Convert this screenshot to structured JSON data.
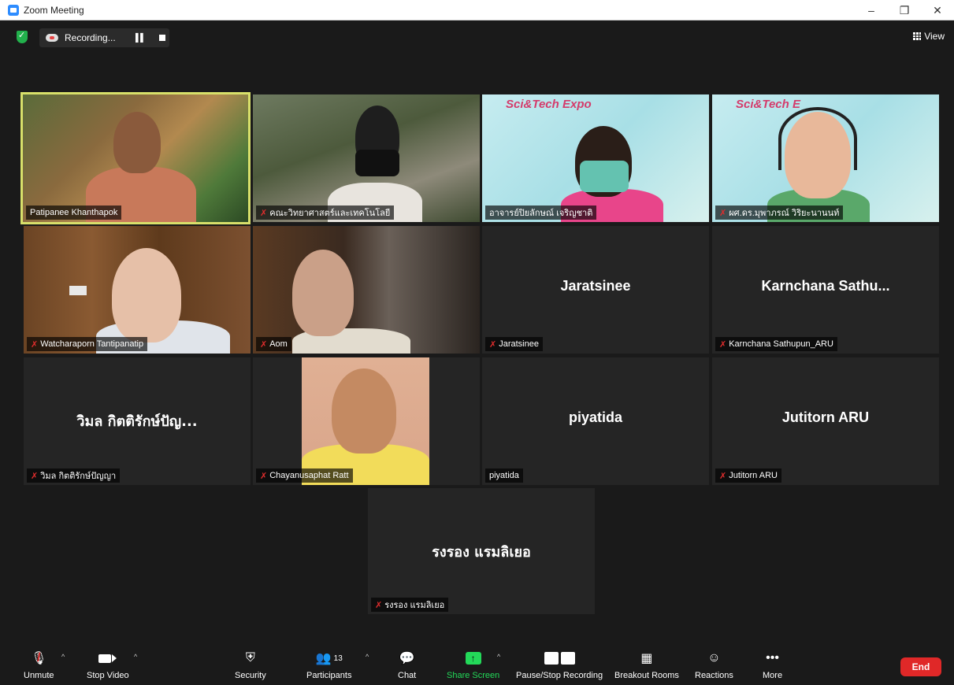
{
  "window": {
    "title": "Zoom Meeting",
    "controls": [
      "–",
      "❐",
      "✕"
    ]
  },
  "topbar": {
    "recording_label": "Recording...",
    "view_label": "View"
  },
  "tiles": [
    {
      "name": "Patipanee Khanthapok",
      "display": "",
      "muted": false
    },
    {
      "name": "คณะวิทยาศาสตร์และเทคโนโลยี",
      "display": "",
      "muted": true
    },
    {
      "name": "อาจารย์ปิยลักษณ์ เจริญชาติ",
      "display": "",
      "muted": false,
      "banner": "Sci&Tech Expo"
    },
    {
      "name": "ผศ.ดร.มุพาภรณ์ วิริยะนานนท์",
      "display": "",
      "muted": true,
      "banner": "Sci&Tech E"
    },
    {
      "name": "Watcharaporn Tantipanatip",
      "display": "",
      "muted": true
    },
    {
      "name": "Aom",
      "display": "",
      "muted": true
    },
    {
      "name": "Jaratsinee",
      "display": "Jaratsinee",
      "muted": true
    },
    {
      "name": "Karnchana Sathupun_ARU",
      "display": "Karnchana Sathu...",
      "muted": true
    },
    {
      "name": "วิมล กิตติรักษ์ปัญญา",
      "display": "วิมล กิตติรักษ์ปัญ...",
      "muted": true
    },
    {
      "name": "Chayanusaphat Ratt",
      "display": "",
      "muted": true
    },
    {
      "name": "piyatida",
      "display": "piyatida",
      "muted": false
    },
    {
      "name": "Jutitorn ARU",
      "display": "Jutitorn ARU",
      "muted": true
    },
    {
      "name": "รงรอง แรมลิเยอ",
      "display": "รงรอง แรมลิเยอ",
      "muted": true
    }
  ],
  "toolbar": {
    "unmute": "Unmute",
    "stop_video": "Stop Video",
    "security": "Security",
    "participants": "Participants",
    "participants_count": "13",
    "chat": "Chat",
    "share_screen": "Share Screen",
    "pause_stop_recording": "Pause/Stop Recording",
    "breakout_rooms": "Breakout Rooms",
    "reactions": "Reactions",
    "more": "More",
    "end": "End"
  },
  "colors": {
    "share_green": "#23d959",
    "end_red": "#e02828",
    "active_speaker": "#d8e06a",
    "muted_red": "#e02d2d"
  }
}
